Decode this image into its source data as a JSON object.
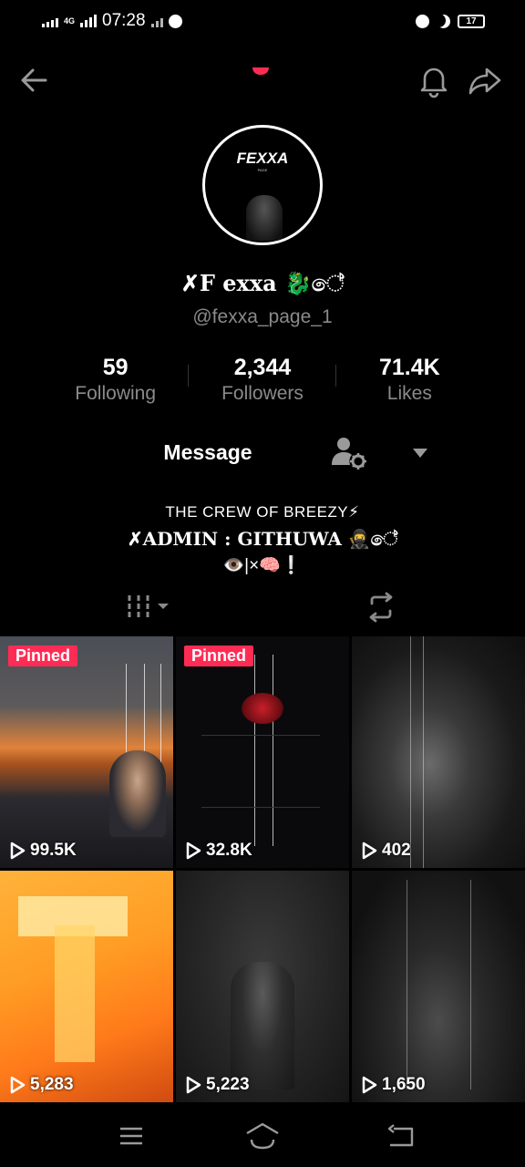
{
  "status_bar": {
    "network": "4G",
    "time": "07:28",
    "battery": "17"
  },
  "profile": {
    "avatar_logo": "FEXXA",
    "avatar_sub": "PAGE",
    "display_name": "✗F exxa 🐉ේ",
    "username": "@fexxa_page_1"
  },
  "stats": [
    {
      "num": "59",
      "label": "Following"
    },
    {
      "num": "2,344",
      "label": "Followers"
    },
    {
      "num": "71.4K",
      "label": "Likes"
    }
  ],
  "actions": {
    "message_label": "Message"
  },
  "bio": {
    "line1": "THE CREW OF BREEZY⚡",
    "line2": "✗ADMIN : GITHUWA 🥷ේ",
    "line3": "👁️|×🧠❕"
  },
  "videos": [
    {
      "views": "99.5K",
      "pinned": "Pinned"
    },
    {
      "views": "32.8K",
      "pinned": "Pinned"
    },
    {
      "views": "402",
      "pinned": ""
    },
    {
      "views": "5,283",
      "pinned": ""
    },
    {
      "views": "5,223",
      "pinned": ""
    },
    {
      "views": "1,650",
      "pinned": ""
    }
  ],
  "colors": {
    "accent": "#fe2c55",
    "secondary_text": "#8a8a8a"
  }
}
